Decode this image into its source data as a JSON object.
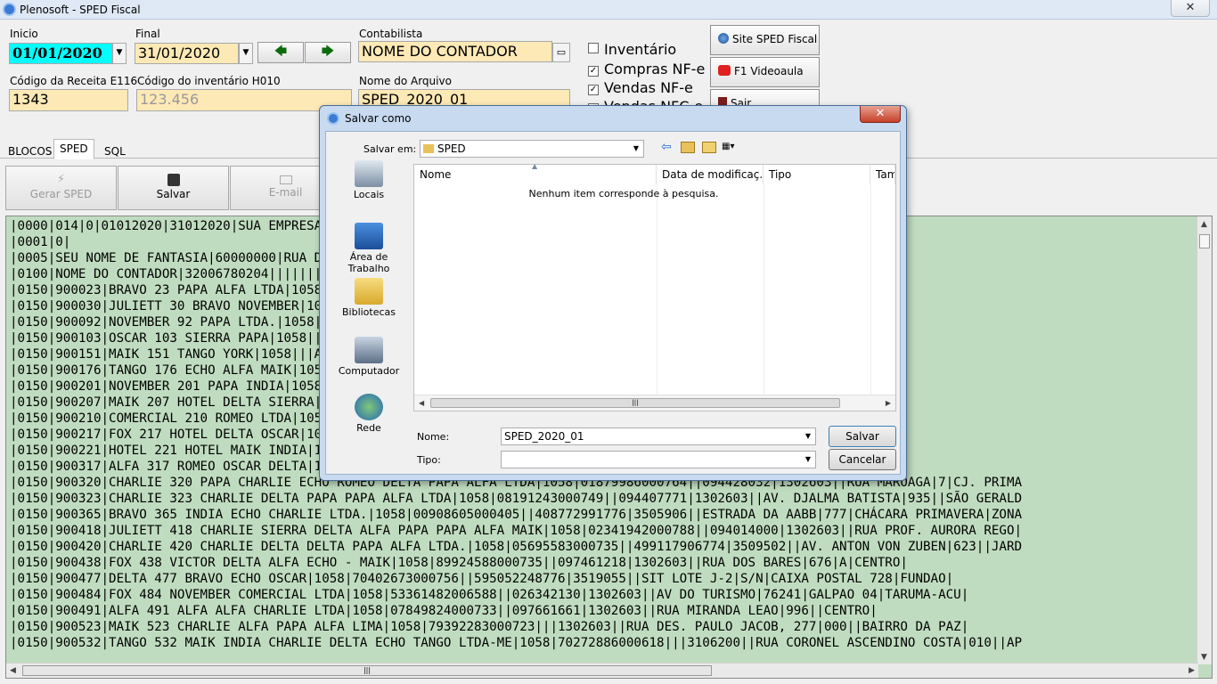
{
  "window": {
    "title": "Plenosoft - SPED Fiscal",
    "close_glyph": "✕"
  },
  "form": {
    "inicio_label": "Inicio",
    "inicio_value": "01/01/2020",
    "final_label": "Final",
    "final_value": "31/01/2020",
    "contabilista_label": "Contabilista",
    "contabilista_value": "NOME DO CONTADOR",
    "receita_label": "Código da Receita E116",
    "receita_value": "1343",
    "inventario_label": "Código do inventário H010",
    "inventario_value": "123.456",
    "arquivo_label": "Nome do Arquivo",
    "arquivo_value": "SPED_2020_01"
  },
  "checks": [
    {
      "label": "Inventário",
      "checked": false
    },
    {
      "label": "Compras NF-e",
      "checked": true
    },
    {
      "label": "Vendas NF-e",
      "checked": true
    },
    {
      "label": "Vendas NFC-e",
      "checked": true
    }
  ],
  "side_buttons": {
    "site": "Site SPED Fiscal",
    "video": "F1 Videoaula",
    "sair": "Sair"
  },
  "tabs": [
    "BLOCOS",
    "SPED",
    "SQL"
  ],
  "toolbar": {
    "gerar": "Gerar SPED",
    "salvar": "Salvar",
    "email": "E-mail"
  },
  "editor_lines": [
    "|0000|014|0|01012020|31012020|SUA EMPRESA LTDA|00000000000000||SP|000000000|3550308|||A|1|",
    "|0001|0|",
    "|0005|SEU NOME DE FANTASIA|60000000|RUA DOS EXEMPLOS|100||CENTRO|||",
    "|0100|NOME DO CONTADOR|32006780204|||||||||contato@plenosoft.com|1302603|",
    "|0150|900023|BRAVO 23 PAPA ALFA LTDA|1058|||ROD. BR 174 KM 9,5 M/D|4||ZONA RURAL|",
    "|0150|900030|JULIETT 30 BRAVO NOVEMBER|1058|||AV. DOS TAPAJÓS|2794|C|FLORES|",
    "|0150|900092|NOVEMBER 92 PAPA LTDA.|1058|||AL. RIO PRETO|9348||ALPHAVILLE|",
    "|0150|900103|OSCAR 103 SIERRA PAPA|1058|||AV. OLIV. SOARES|7000|TESTE|COL. OLIV. MACHA",
    "|0150|900151|MAIK 151 TANGO YORK|1058|||AVL. LEOPOLDINA|JAGUARÉ|",
    "|0150|900176|TANGO 176 ECHO ALFA MAIK|1058|||MANOEL JACINTO COLEHO JR., S/N|0|",
    "|0150|900201|NOVEMBER 201 PAPA INDIA|1058|||AV. BRASIL|800||DISTRITO INDUSTRIAL",
    "|0150|900207|MAIK 207 HOTEL DELTA SIERRA|1058|||SIMÕES|4169|QD. B40, LOTE 4, 6, 9",
    "|0150|900210|COMERCIAL 210 ROMEO LTDA|1058|||90||FLORES|",
    "|0150|900217|FOX 217 HOTEL DELTA OSCAR|1058|||PROFESSOR PAULO GRACA|4202||TARUMA AC",
    "|0150|900221|HOTEL 221 HOTEL MAIK INDIA|1058|||RIO BRANCO|232||JARDIM TRÊS MARIAS",
    "|0150|900317|ALFA 317 ROMEO OSCAR DELTA|1058|||74|CONJ. CANARANAS II|CIDADE NOV",
    "|0150|900320|CHARLIE 320 PAPA CHARLIE ECHO ROMEO DELTA PAPA ALFA LTDA|1058|01879986000764||094428032|1302603||RUA MAROAGA|7|CJ. PRIMA",
    "|0150|900323|CHARLIE 323 CHARLIE DELTA PAPA PAPA ALFA LTDA|1058|08191243000749||094407771|1302603||AV. DJALMA BATISTA|935||SÃO GERALD",
    "|0150|900365|BRAVO 365 INDIA ECHO CHARLIE LTDA.|1058|00908605000405||408772991776|3505906||ESTRADA DA AABB|777|CHÁCARA PRIMAVERA|ZONA",
    "|0150|900418|JULIETT 418 CHARLIE SIERRA DELTA ALFA PAPA PAPA ALFA MAIK|1058|02341942000788||094014000|1302603||RUA PROF. AURORA REGO|",
    "|0150|900420|CHARLIE 420 CHARLIE DELTA DELTA PAPA ALFA LTDA.|1058|05695583000735||499117906774|3509502||AV. ANTON VON ZUBEN|623||JARD",
    "|0150|900438|FOX 438 VICTOR DELTA ALFA ECHO - MAIK|1058|89924588000735||097461218|1302603||RUA DOS BARES|676|A|CENTRO|",
    "|0150|900477|DELTA 477 BRAVO ECHO OSCAR|1058|70402673000756||595052248776|3519055||SIT LOTE J-2|S/N|CAIXA POSTAL 728|FUNDAO|",
    "|0150|900484|FOX 484 NOVEMBER COMERCIAL LTDA|1058|53361482006588||026342130|1302603||AV DO TURISMO|76241|GALPAO 04|TARUMA-ACU|",
    "|0150|900491|ALFA 491 ALFA ALFA CHARLIE LTDA|1058|07849824000733||097661661|1302603||RUA MIRANDA LEAO|996||CENTRO|",
    "|0150|900523|MAIK 523 CHARLIE ALFA PAPA ALFA LIMA|1058|79392283000723|||1302603||RUA DES. PAULO JACOB, 277|000||BAIRRO DA PAZ|",
    "|0150|900532|TANGO 532 MAIK INDIA CHARLIE DELTA ECHO TANGO LTDA-ME|1058|70272886000618|||3106200||RUA CORONEL ASCENDINO COSTA|010||AP"
  ],
  "dialog": {
    "title": "Salvar como",
    "close_glyph": "✕",
    "salvar_em_label": "Salvar em:",
    "folder": "SPED",
    "places": [
      "Locais",
      "Área de Trabalho",
      "Bibliotecas",
      "Computador",
      "Rede"
    ],
    "columns": [
      "Nome",
      "Data de modificaç...",
      "Tipo",
      "Tam"
    ],
    "empty_message": "Nenhum item corresponde à pesquisa.",
    "nome_label": "Nome:",
    "nome_value": "SPED_2020_01",
    "tipo_label": "Tipo:",
    "tipo_value": "",
    "save_button": "Salvar",
    "cancel_button": "Cancelar"
  },
  "colors": {
    "editor_bg": "#c0dcc0",
    "field_bg": "#fde9b6",
    "date_bg": "#00ffff"
  }
}
